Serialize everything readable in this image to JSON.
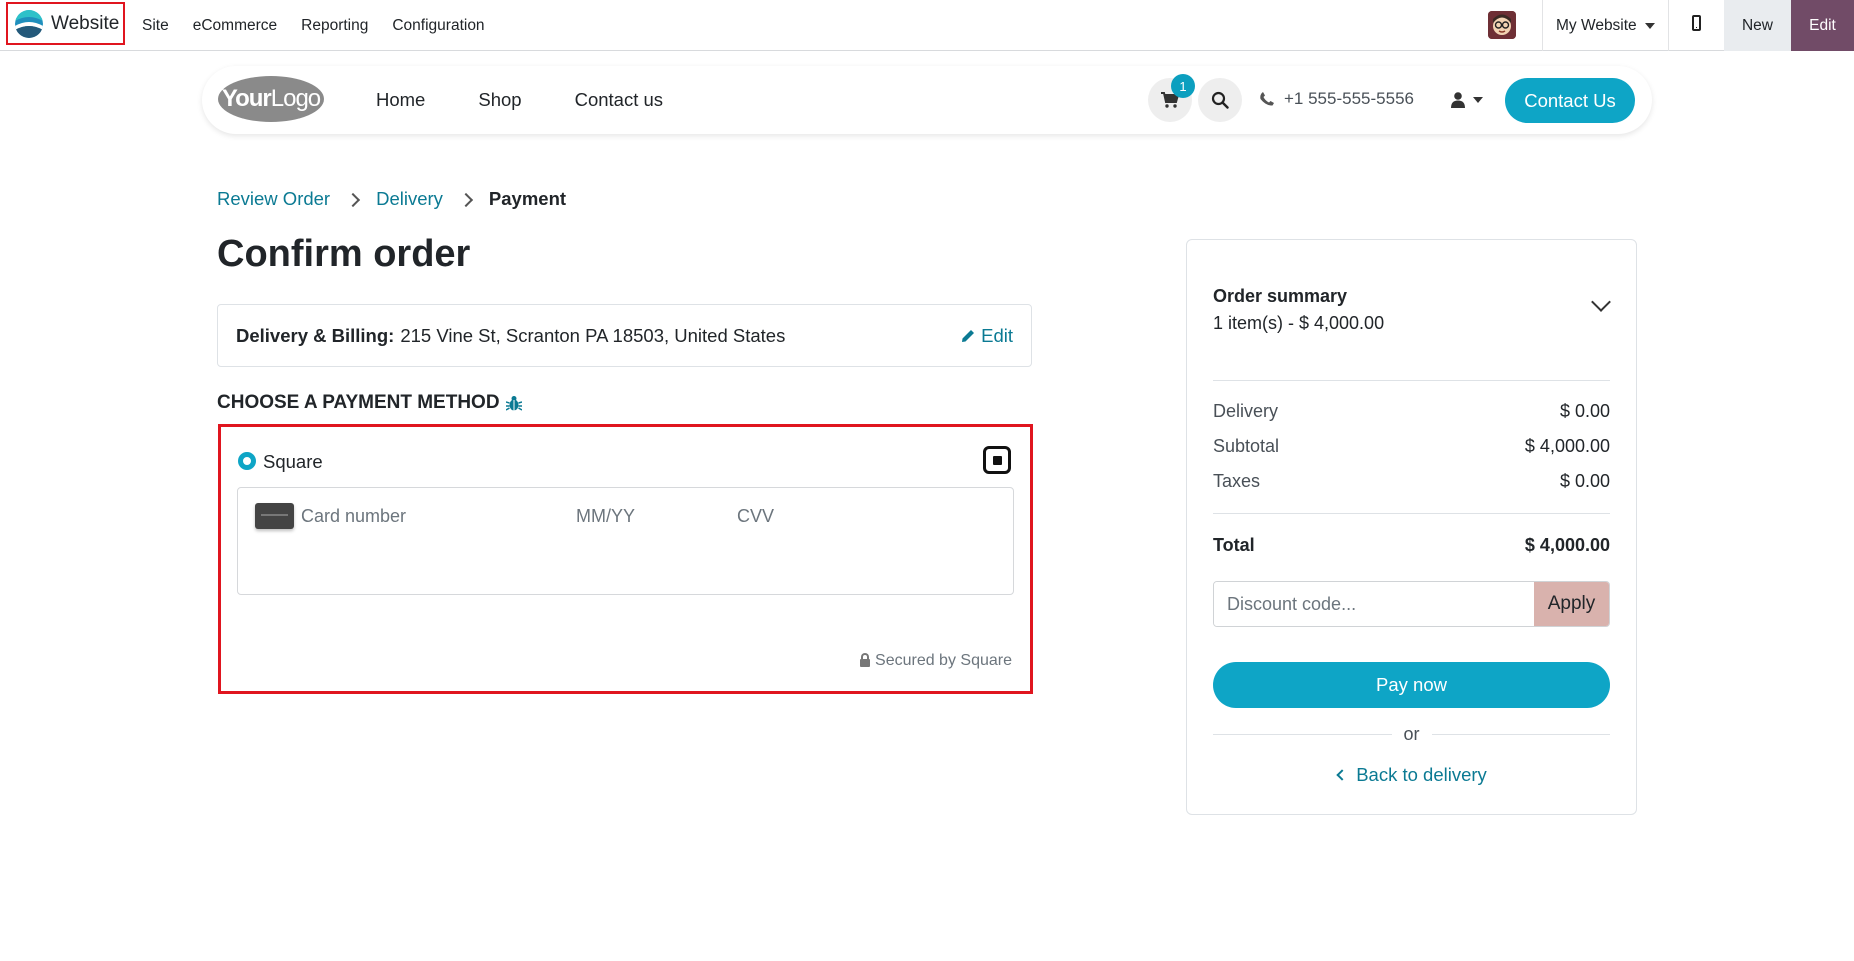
{
  "topbar": {
    "app_name": "Website",
    "menu": [
      "Site",
      "eCommerce",
      "Reporting",
      "Configuration"
    ],
    "website_selector": "My Website",
    "new_label": "New",
    "edit_label": "Edit"
  },
  "header": {
    "logo": {
      "bold": "Your",
      "rest": "Logo"
    },
    "nav": [
      "Home",
      "Shop",
      "Contact us"
    ],
    "cart_count": "1",
    "phone": "+1 555-555-5556",
    "contact_button": "Contact Us"
  },
  "breadcrumb": {
    "step1": "Review Order",
    "step2": "Delivery",
    "current": "Payment"
  },
  "page_title": "Confirm order",
  "address": {
    "label": "Delivery & Billing:",
    "value": "215 Vine St, Scranton PA 18503, United States",
    "edit": "Edit"
  },
  "payment": {
    "section_title": "CHOOSE A PAYMENT METHOD",
    "method": "Square",
    "card_number_placeholder": "Card number",
    "expiry_placeholder": "MM/YY",
    "cvv_placeholder": "CVV",
    "secured_text": "Secured by Square"
  },
  "summary": {
    "title": "Order summary",
    "items": "1 item(s) -  $ 4,000.00",
    "delivery_label": "Delivery",
    "delivery_value": "$ 0.00",
    "subtotal_label": "Subtotal",
    "subtotal_value": "$ 4,000.00",
    "taxes_label": "Taxes",
    "taxes_value": "$ 0.00",
    "total_label": "Total",
    "total_value": "$ 4,000.00",
    "discount_placeholder": "Discount code...",
    "apply": "Apply",
    "pay_now": "Pay now",
    "or": "or",
    "back": "Back to delivery"
  },
  "colors": {
    "accent": "#0ea5c6",
    "link": "#0b7a93",
    "edit_purple": "#714b67",
    "highlight_red": "#e0151f",
    "apply_bg": "#d9b2ad"
  }
}
